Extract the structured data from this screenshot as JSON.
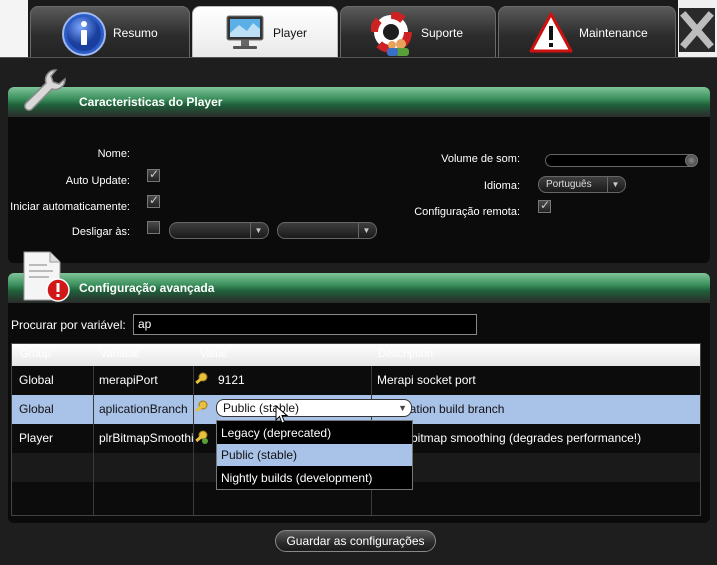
{
  "tabs": [
    {
      "label": "Resumo",
      "icon": "info-icon"
    },
    {
      "label": "Player",
      "icon": "monitor-icon"
    },
    {
      "label": "Suporte",
      "icon": "lifebuoy-icon"
    },
    {
      "label": "Maintenance",
      "icon": "warning-icon"
    }
  ],
  "player_section": {
    "title": "Caracteristicas do Player",
    "nome_label": "Nome:",
    "auto_update_label": "Auto Update:",
    "auto_update_checked": true,
    "iniciar_label": "Iniciar automaticamente:",
    "iniciar_checked": true,
    "desligar_label": "Desligar às:",
    "desligar_checked": false,
    "volume_label": "Volume de som:",
    "volume_level": 1.0,
    "idioma_label": "Idioma:",
    "idioma_value": "Português",
    "remote_label": "Configuração remota:",
    "remote_checked": true
  },
  "advanced_section": {
    "title": "Configuração avançada",
    "search_label": "Procurar por variável:",
    "search_value": "ap",
    "columns": [
      "Group",
      "Variable",
      "Value",
      "Description"
    ],
    "rows": [
      {
        "group": "Global",
        "variable": "merapiPort",
        "value": "9121",
        "description": "Merapi socket port"
      },
      {
        "group": "Global",
        "variable": "aplicationBranch",
        "value": "Public (stable)",
        "description": "Application build branch"
      },
      {
        "group": "Player",
        "variable": "plrBitmapSmoothing",
        "value": "",
        "description": "Force bitmap smoothing (degrades performance!)"
      }
    ],
    "dropdown_options": [
      "Legacy (deprecated)",
      "Public (stable)",
      "Nightly builds (development)"
    ],
    "dropdown_selected": "Public (stable)"
  },
  "save_button_label": "Guardar as configurações",
  "colors": {
    "header_green": "#3b8f5c",
    "selection_blue": "#a9c2e8",
    "dialog_bg": "#1e1e1e"
  }
}
